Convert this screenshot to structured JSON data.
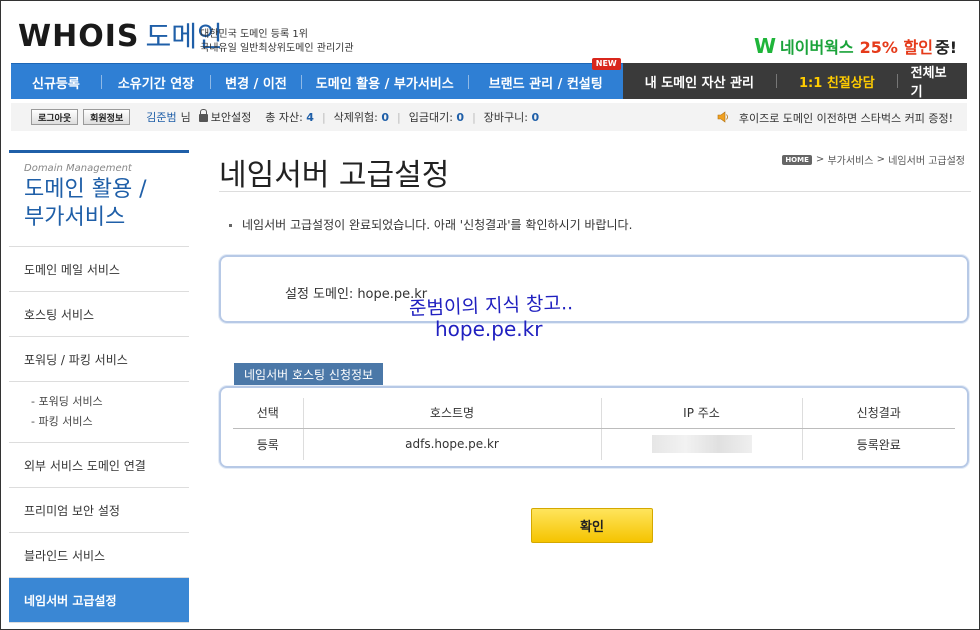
{
  "header": {
    "logo_main": "WHOIS",
    "logo_domain": "도메인",
    "tagline_1": "대한민국 도메인 등록 1위",
    "tagline_2": "국내유일 일반최상위도메인 관리기관",
    "promo_w": "W",
    "promo_text": "네이버웍스",
    "promo_pct": "25% 할인",
    "promo_end": "중!"
  },
  "nav": {
    "blue_items": [
      "신규등록",
      "소유기간 연장",
      "변경 / 이전",
      "도메인 활용 / 부가서비스",
      "브랜드 관리 / 컨설팅"
    ],
    "new_badge": "NEW",
    "dark_items": [
      "내 도메인 자산 관리",
      "1:1 친절상담",
      "전체보기"
    ]
  },
  "userbar": {
    "logout": "로그아웃",
    "member_info": "회원정보",
    "user_name": "김준범",
    "suffix": "님",
    "security": "보안설정",
    "stats": [
      {
        "label": "총 자산:",
        "value": "4"
      },
      {
        "label": "삭제위험:",
        "value": "0"
      },
      {
        "label": "입금대기:",
        "value": "0"
      },
      {
        "label": "장바구니:",
        "value": "0"
      }
    ],
    "notice": "후이즈로 도메인 이전하면 스타벅스 커피 증정!"
  },
  "sidebar": {
    "subtitle": "Domain Management",
    "title_1": "도메인 활용 /",
    "title_2": "부가서비스",
    "items": [
      "도메인 메일 서비스",
      "호스팅 서비스",
      "포워딩 / 파킹 서비스"
    ],
    "sub_items": [
      "- 포워딩 서비스",
      "- 파킹 서비스"
    ],
    "items_after": [
      "외부 서비스 도메인 연결",
      "프리미엄 보안 설정",
      "블라인드 서비스"
    ],
    "active": "네임서버 고급설정"
  },
  "main": {
    "title": "네임서버 고급설정",
    "breadcrumb_home": "HOME",
    "breadcrumb_1": "부가서비스",
    "breadcrumb_2": "네임서버 고급설정",
    "breadcrumb_sep": ">",
    "notice": "네임서버 고급설정이 완료되었습니다. 아래 '신청결과'를 확인하시기 바랍니다.",
    "domain_label": "설정 도메인:",
    "domain_value": "hope.pe.kr",
    "watermark_1": "준범이의 지식 창고..",
    "watermark_2": "hope.pe.kr",
    "section_tab": "네임서버 호스팅 신청정보",
    "table": {
      "headers": [
        "선택",
        "호스트명",
        "IP 주소",
        "신청결과"
      ],
      "row": [
        "등록",
        "adfs.hope.pe.kr",
        "",
        "등록완료"
      ]
    },
    "ok_button": "확인"
  }
}
